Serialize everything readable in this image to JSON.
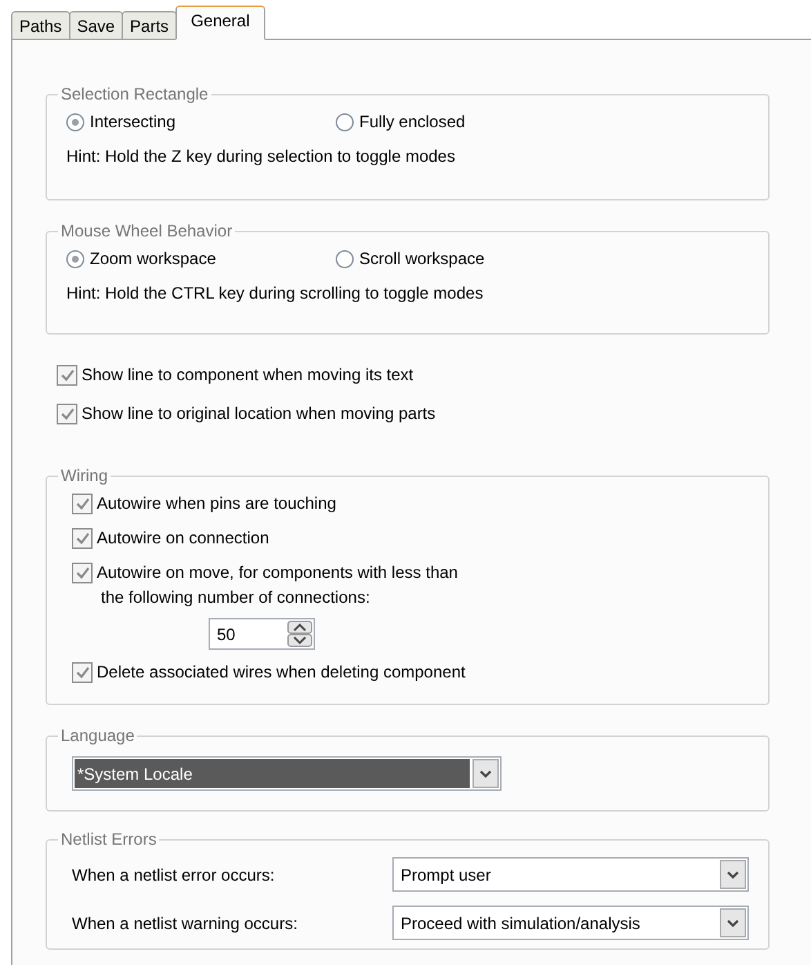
{
  "tabs": [
    {
      "label": "Paths",
      "selected": false
    },
    {
      "label": "Save",
      "selected": false
    },
    {
      "label": "Parts",
      "selected": false
    },
    {
      "label": "General",
      "selected": true
    }
  ],
  "selection_rectangle": {
    "title": "Selection Rectangle",
    "options": [
      {
        "label": "Intersecting",
        "selected": true
      },
      {
        "label": "Fully enclosed",
        "selected": false
      }
    ],
    "hint": "Hint: Hold the Z key during selection to toggle modes"
  },
  "mouse_wheel": {
    "title": "Mouse Wheel Behavior",
    "options": [
      {
        "label": "Zoom workspace",
        "selected": true
      },
      {
        "label": "Scroll workspace",
        "selected": false
      }
    ],
    "hint": "Hint: Hold the CTRL key during scrolling to toggle modes"
  },
  "display_options": [
    {
      "label": "Show line to component when moving its text",
      "checked": true
    },
    {
      "label": "Show line to original location when moving parts",
      "checked": true
    }
  ],
  "wiring": {
    "title": "Wiring",
    "items": [
      {
        "label": "Autowire when pins are touching",
        "checked": true
      },
      {
        "label": "Autowire on connection",
        "checked": true
      },
      {
        "label": "Autowire on move, for components with less than",
        "checked": true,
        "sublabel": "the following number of connections:",
        "spinner_value": "50"
      },
      {
        "label": "Delete associated wires when deleting component",
        "checked": true
      }
    ]
  },
  "language": {
    "title": "Language",
    "value": "*System Locale",
    "highlighted": true
  },
  "netlist_errors": {
    "title": "Netlist Errors",
    "rows": [
      {
        "label": "When a netlist error occurs:",
        "value": "Prompt user"
      },
      {
        "label": "When a netlist warning occurs:",
        "value": "Proceed with simulation/analysis"
      }
    ]
  }
}
